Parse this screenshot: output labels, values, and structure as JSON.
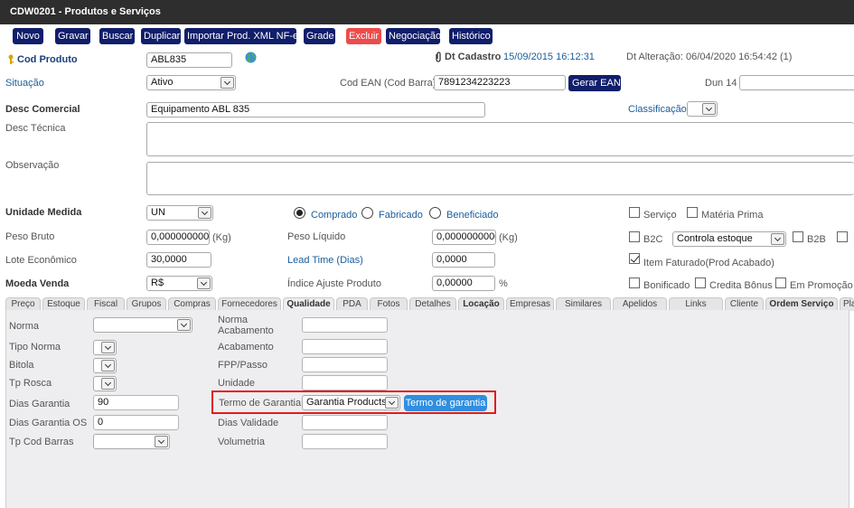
{
  "window": {
    "title": "CDW0201 - Produtos e Serviços"
  },
  "toolbar": {
    "buttons": [
      "Novo",
      "Gravar",
      "Buscar",
      "Duplicar",
      "Importar Prod. XML NF-e",
      "Grade",
      "Excluir",
      "Negociação",
      "Histórico"
    ]
  },
  "header": {
    "cod_produto_label": "Cod Produto",
    "cod_produto_value": "ABL835",
    "dt_cadastro_label": "Dt Cadastro",
    "dt_cadastro_value": "15/09/2015 16:12:31",
    "dt_alteracao": "Dt Alteração: 06/04/2020 16:54:42 (1)",
    "situacao_label": "Situação",
    "situacao_value": "Ativo",
    "cod_ean_label": "Cod EAN (Cod Barra)",
    "cod_ean_value": "7891234223223",
    "gerar_ean_label": "Gerar EAN",
    "dun14_label": "Dun 14",
    "dun14_value": "",
    "desc_comercial_label": "Desc Comercial",
    "desc_comercial_value": "Equipamento ABL 835",
    "classificacao_label": "Classificação",
    "classificacao_value": "",
    "desc_tecnica_label": "Desc Técnica",
    "observacao_label": "Observação"
  },
  "details": {
    "unidade_medida_label": "Unidade Medida",
    "unidade_medida_value": "UN",
    "radio_comprado": "Comprado",
    "radio_fabricado": "Fabricado",
    "radio_beneficiado": "Beneficiado",
    "servico_label": "Serviço",
    "materia_prima_label": "Matéria Prima",
    "peso_bruto_label": "Peso Bruto",
    "peso_bruto_value": "0,0000000000",
    "peso_bruto_unit": "(Kg)",
    "peso_liquido_label": "Peso Líquido",
    "peso_liquido_value": "0,0000000000",
    "peso_liquido_unit": "(Kg)",
    "b2c_label": "B2C",
    "controla_estoque_value": "Controla estoque",
    "b2b_label": "B2B",
    "lote_economico_label": "Lote Econômico",
    "lote_economico_value": "30,0000",
    "lead_time_label": "Lead Time (Dias)",
    "lead_time_value": "0,0000",
    "item_faturado_label": "Item Faturado(Prod Acabado)",
    "moeda_venda_label": "Moeda Venda",
    "moeda_venda_value": "R$",
    "indice_ajuste_label": "Índice Ajuste Produto",
    "indice_ajuste_value": "0,00000",
    "indice_ajuste_unit": "%",
    "bonificado_label": "Bonificado",
    "credita_bonus_label": "Credita Bônus",
    "em_promocao_label": "Em Promoção"
  },
  "tabs": [
    "Preço",
    "Estoque",
    "Fiscal",
    "Grupos",
    "Compras",
    "Fornecedores",
    "Qualidade",
    "PDA",
    "Fotos",
    "Detalhes",
    "Locação",
    "Empresas",
    "Similares",
    "Apelidos",
    "Links",
    "Cliente",
    "Ordem Serviço",
    "Pla"
  ],
  "qualidade": {
    "norma_label": "Norma",
    "tipo_norma_label": "Tipo Norma",
    "bitola_label": "Bitola",
    "tp_rosca_label": "Tp Rosca",
    "dias_garantia_label": "Dias Garantia",
    "dias_garantia_value": "90",
    "dias_garantia_os_label": "Dias Garantia OS",
    "dias_garantia_os_value": "0",
    "tp_cod_barras_label": "Tp Cod Barras",
    "norma_acabamento_label_1": "Norma",
    "norma_acabamento_label_2": "Acabamento",
    "acabamento_label": "Acabamento",
    "fpp_passo_label": "FPP/Passo",
    "unidade_label": "Unidade",
    "termo_garantia_label": "Termo de Garantia",
    "termo_garantia_value": "Garantia Products",
    "termo_garantia_button": "Termo de garantia",
    "dias_validade_label": "Dias Validade",
    "volumetria_label": "Volumetria"
  },
  "colors": {
    "titlebar": "#2e2e2e",
    "button_navy": "#101e6b",
    "button_red": "#ee4b4b",
    "link_blue": "#1a5c9c",
    "highlight_red": "#e21b1b",
    "termo_button_blue": "#2f8ee0"
  }
}
